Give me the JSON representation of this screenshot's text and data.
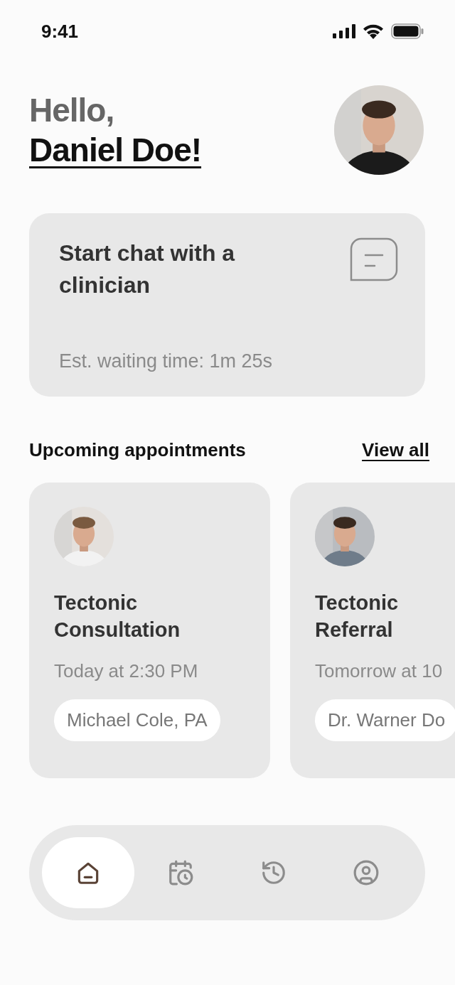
{
  "status_bar": {
    "time": "9:41"
  },
  "greeting": {
    "line1": "Hello,",
    "line2": "Daniel Doe!"
  },
  "chat_card": {
    "title": "Start chat with a clinician",
    "wait": "Est. waiting time: 1m 25s"
  },
  "appointments": {
    "title": "Upcoming appointments",
    "link": "View all",
    "items": [
      {
        "title": "Tectonic Consultation",
        "time": "Today at 2:30 PM",
        "clinician": "Michael Cole, PA"
      },
      {
        "title": "Tectonic Referral",
        "time": "Tomorrow at 10",
        "clinician": "Dr. Warner Do"
      }
    ]
  },
  "nav": [
    {
      "kind": "home",
      "selected": true
    },
    {
      "kind": "appointments",
      "selected": false
    },
    {
      "kind": "history",
      "selected": false
    },
    {
      "kind": "profile",
      "selected": false
    }
  ]
}
